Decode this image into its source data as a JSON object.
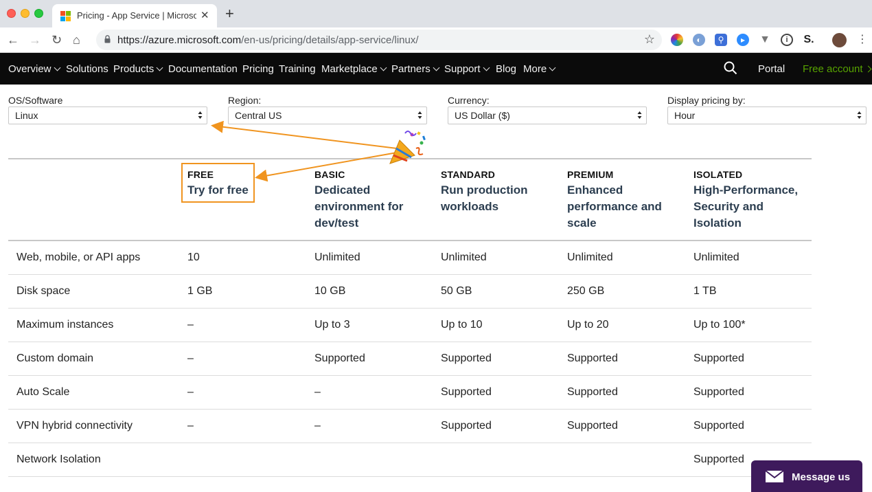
{
  "browser": {
    "tab_title": "Pricing - App Service | Microsoft Azure",
    "url_host": "https://azure.microsoft.com",
    "url_path": "/en-us/pricing/details/app-service/linux/"
  },
  "nav": {
    "items": [
      {
        "label": "Overview",
        "dropdown": true
      },
      {
        "label": "Solutions",
        "dropdown": false
      },
      {
        "label": "Products",
        "dropdown": true
      },
      {
        "label": "Documentation",
        "dropdown": false
      },
      {
        "label": "Pricing",
        "dropdown": false
      },
      {
        "label": "Training",
        "dropdown": false
      },
      {
        "label": "Marketplace",
        "dropdown": true
      },
      {
        "label": "Partners",
        "dropdown": true
      },
      {
        "label": "Support",
        "dropdown": true
      },
      {
        "label": "Blog",
        "dropdown": false
      },
      {
        "label": "More",
        "dropdown": true
      }
    ],
    "portal": "Portal",
    "free_account": "Free account"
  },
  "filters": {
    "os": {
      "label": "OS/Software",
      "value": "Linux"
    },
    "region": {
      "label": "Region:",
      "value": "Central US"
    },
    "currency": {
      "label": "Currency:",
      "value": "US Dollar ($)"
    },
    "display": {
      "label": "Display pricing by:",
      "value": "Hour"
    }
  },
  "tiers": [
    {
      "name": "FREE",
      "desc": "Try for free"
    },
    {
      "name": "BASIC",
      "desc": "Dedicated environment for dev/test"
    },
    {
      "name": "STANDARD",
      "desc": "Run production workloads"
    },
    {
      "name": "PREMIUM",
      "desc": "Enhanced performance and scale"
    },
    {
      "name": "ISOLATED",
      "desc": "High-Performance, Security and Isolation"
    }
  ],
  "rows": [
    {
      "feature": "Web, mobile, or API apps",
      "values": [
        "10",
        "Unlimited",
        "Unlimited",
        "Unlimited",
        "Unlimited"
      ]
    },
    {
      "feature": "Disk space",
      "values": [
        "1 GB",
        "10 GB",
        "50 GB",
        "250 GB",
        "1 TB"
      ]
    },
    {
      "feature": "Maximum instances",
      "values": [
        "–",
        "Up to 3",
        "Up to 10",
        "Up to 20",
        "Up to 100*"
      ]
    },
    {
      "feature": "Custom domain",
      "values": [
        "–",
        "Supported",
        "Supported",
        "Supported",
        "Supported"
      ]
    },
    {
      "feature": "Auto Scale",
      "values": [
        "–",
        "–",
        "Supported",
        "Supported",
        "Supported"
      ]
    },
    {
      "feature": "VPN hybrid connectivity",
      "values": [
        "–",
        "–",
        "Supported",
        "Supported",
        "Supported"
      ]
    },
    {
      "feature": "Network Isolation",
      "values": [
        "",
        "",
        "",
        "",
        "Supported"
      ]
    }
  ],
  "chat": {
    "label": "Message us"
  },
  "colors": {
    "accent_annotation": "#f0941f",
    "free_account": "#57a300",
    "nav_bg": "#0b0b0b",
    "chat_bg": "#3e1a5c"
  }
}
